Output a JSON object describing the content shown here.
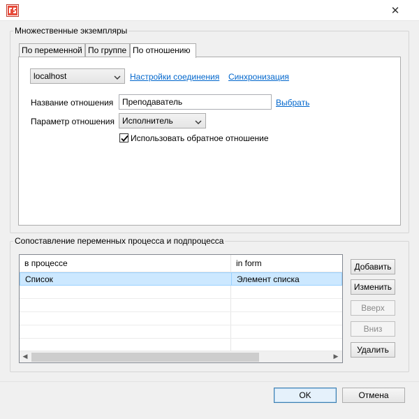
{
  "window": {
    "close_glyph": "✕"
  },
  "multi_instance": {
    "group_title": "Множественные экземпляры",
    "tabs": [
      {
        "label": "По переменной"
      },
      {
        "label": "По группе"
      },
      {
        "label": "По отношению"
      }
    ],
    "active_tab": 2,
    "server_combo": {
      "value": "localhost"
    },
    "connection_settings_link": "Настройки соединения",
    "sync_link": "Синхронизация",
    "relation_name_label": "Название отношения",
    "relation_name_value": "Преподаватель",
    "choose_link": "Выбрать",
    "relation_param_label": "Параметр отношения",
    "relation_param_value": "Исполнитель",
    "reverse_checkbox": {
      "label": "Использовать обратное отношение",
      "checked": true
    }
  },
  "mapping": {
    "group_title": "Сопоставление переменных процесса и подпроцесса",
    "columns": [
      "в процессе",
      "in form"
    ],
    "rows": [
      {
        "in_process": "Список",
        "in_form": "Элемент списка",
        "selected": true
      }
    ],
    "empty_rows": 5,
    "buttons": {
      "add": "Добавить",
      "edit": "Изменить",
      "up": "Вверх",
      "down": "Вниз",
      "delete": "Удалить"
    }
  },
  "footer": {
    "ok": "OK",
    "cancel": "Отмена"
  },
  "colors": {
    "link": "#0066cc",
    "selection": "#cce8ff",
    "dialog_bg": "#f0f0f0"
  }
}
